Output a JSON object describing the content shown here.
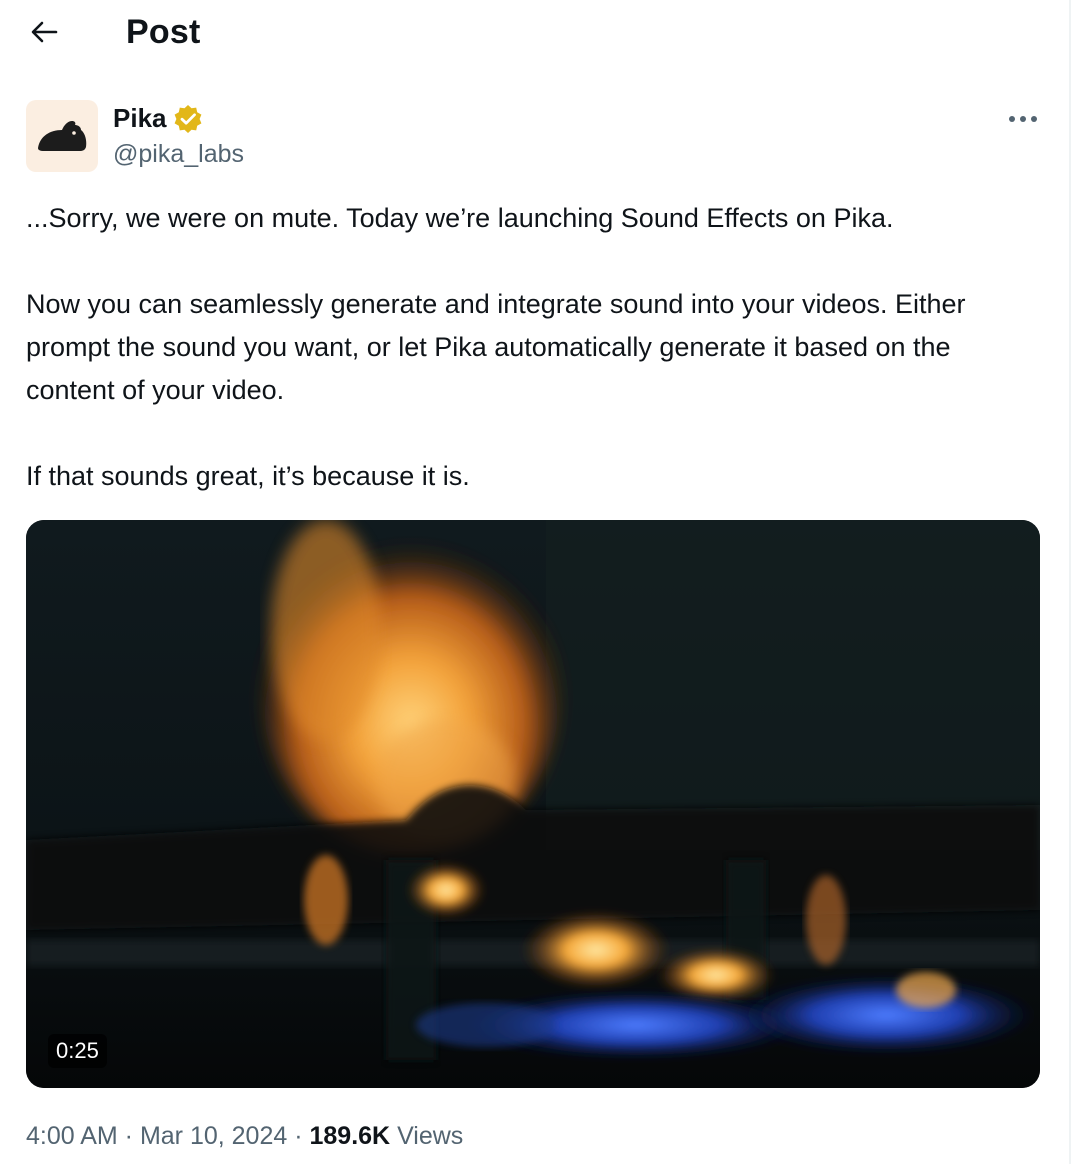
{
  "header": {
    "title": "Post"
  },
  "author": {
    "name": "Pika",
    "handle": "@pika_labs",
    "verified_color": "#e2b719"
  },
  "post": {
    "paragraphs": [
      "...Sorry, we were on mute. Today we’re launching Sound Effects on Pika.",
      "Now you can seamlessly generate and integrate sound into your videos. Either prompt the sound you want, or let Pika automatically generate it based on the content of your video.",
      "If that sounds great, it’s because it is."
    ],
    "video": {
      "duration": "0:25"
    },
    "meta": {
      "time": "4:00 AM",
      "separator1": " · ",
      "date": "Mar 10, 2024",
      "separator2": " · ",
      "views_count": "189.6K",
      "views_label": " Views"
    }
  },
  "icons": {
    "back": "arrow-left-icon",
    "verified": "verified-badge-icon",
    "more": "more-horizontal-icon",
    "avatar": "rabbit-logo-icon"
  }
}
